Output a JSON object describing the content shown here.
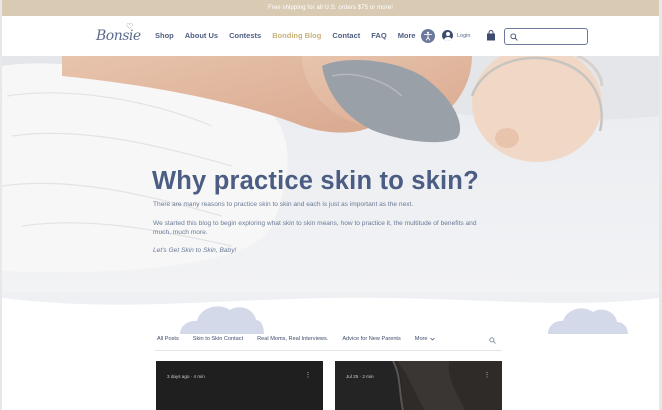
{
  "announcement": "Free shipping for all U.S. orders $75 or more!",
  "brand": {
    "logo_text": "Bonsie",
    "colors": {
      "navy": "#4c5d84",
      "gold": "#c9b27a",
      "beige": "#d9cbb3",
      "cloud": "#d4d9ea"
    }
  },
  "nav": {
    "items": [
      {
        "label": "Shop"
      },
      {
        "label": "About Us"
      },
      {
        "label": "Contests"
      },
      {
        "label": "Bonding Blog",
        "active": true
      },
      {
        "label": "Contact"
      },
      {
        "label": "FAQ"
      },
      {
        "label": "More"
      }
    ]
  },
  "header": {
    "accessibility_icon": "accessibility-icon",
    "login_label": "Login",
    "cart_icon": "shopping-bag-icon",
    "search_icon": "search-icon",
    "search_value": ""
  },
  "hero": {
    "title": "Why practice skin to skin?",
    "paragraph_1": "There are many reasons to practice skin to skin and each is just as important as the next.",
    "paragraph_2": "We started this blog to begin exploring what skin to skin means, how to practice it, the multitude of benefits and much, much more.",
    "paragraph_3": "Let's Get Skin to Skin, Baby!"
  },
  "blog": {
    "categories": [
      {
        "label": "All Posts"
      },
      {
        "label": "Skin to Skin Contact"
      },
      {
        "label": "Real Moms, Real Interviews."
      },
      {
        "label": "Advice for New Parents"
      },
      {
        "label": "More"
      }
    ],
    "more_icon": "chevron-down-icon",
    "search_icon": "search-icon",
    "posts": [
      {
        "meta": "3 days ago  ·  4 min",
        "menu_icon": "more-vertical-icon"
      },
      {
        "meta": "Jul 25  ·  2 min",
        "menu_icon": "more-vertical-icon"
      }
    ]
  }
}
